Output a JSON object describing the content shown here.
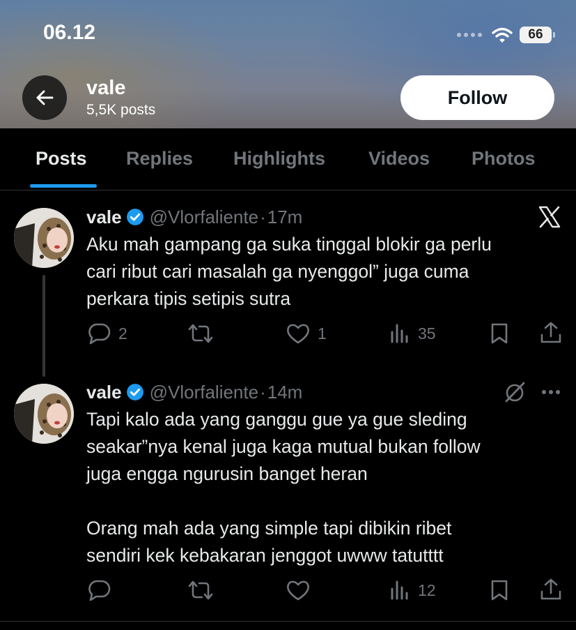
{
  "status_bar": {
    "time": "06.12",
    "battery": "66"
  },
  "profile": {
    "name": "vale",
    "posts_count": "5,5K posts",
    "follow_label": "Follow"
  },
  "tabs": [
    "Posts",
    "Replies",
    "Highlights",
    "Videos",
    "Photos"
  ],
  "active_tab": "Posts",
  "tweets": [
    {
      "name": "vale",
      "handle": "@Vlorfaliente",
      "sep": "·",
      "time": "17m",
      "text": "Aku mah gampang ga suka tinggal blokir ga perlu\ncari ribut cari masalah ga nyenggol” juga cuma\nperkara tipis setipis sutra",
      "replies": "2",
      "retweets": "",
      "likes": "1",
      "views": "35"
    },
    {
      "name": "vale",
      "handle": "@Vlorfaliente",
      "sep": "·",
      "time": "14m",
      "text": "Tapi kalo ada yang ganggu gue ya gue sleding\nseakar”nya kenal juga kaga mutual bukan follow\njuga engga ngurusin banget heran\n\nOrang mah ada yang simple tapi dibikin ribet\nsendiri kek kebakaran jenggot uwww tatutttt",
      "replies": "",
      "retweets": "",
      "likes": "",
      "views": "12"
    }
  ],
  "icons": [
    "arrow-left-icon",
    "wifi-icon",
    "verified-badge-icon",
    "x-logo-icon",
    "grok-icon",
    "more-icon",
    "reply-icon",
    "retweet-icon",
    "like-icon",
    "views-icon",
    "bookmark-icon",
    "share-icon"
  ],
  "colors": {
    "accent": "#1d9bf0",
    "muted": "#71767b",
    "text": "#e7e9ea",
    "background": "#000000"
  }
}
